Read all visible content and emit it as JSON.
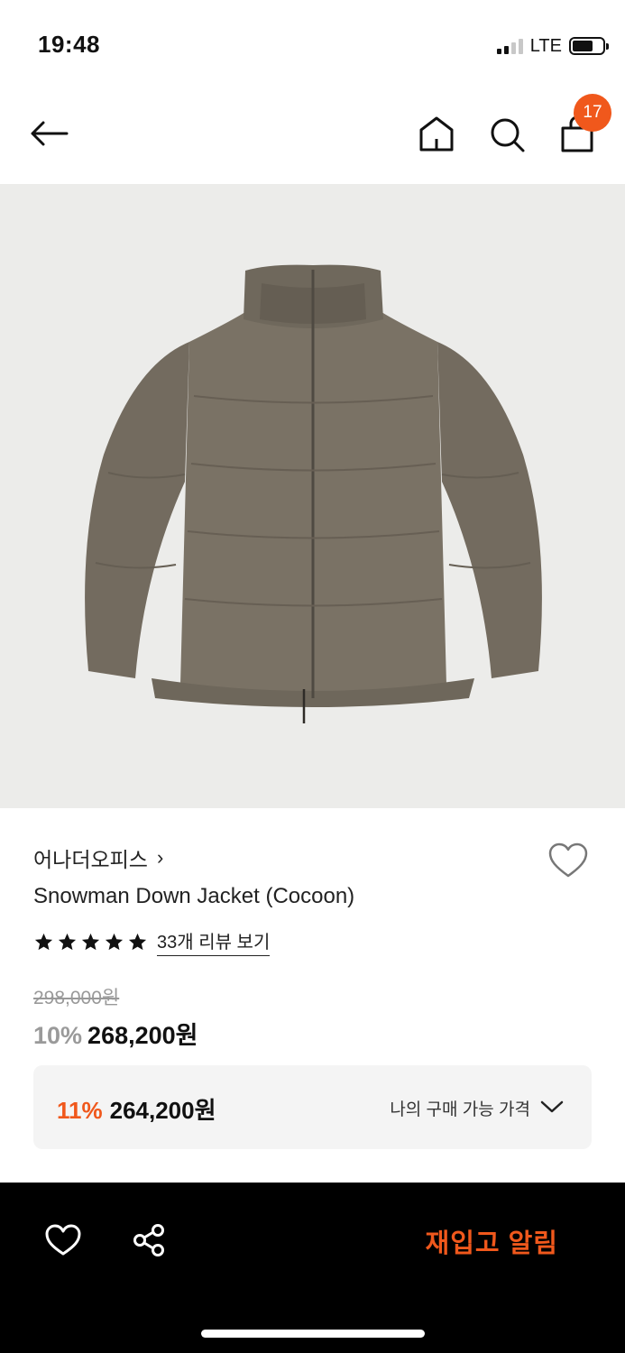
{
  "status_bar": {
    "time": "19:48",
    "network": "LTE"
  },
  "nav": {
    "cart_count": "17"
  },
  "product": {
    "brand": "어나더오피스",
    "brand_chevron": "›",
    "name": "Snowman Down Jacket (Cocoon)",
    "rating_stars": 5,
    "review_link": "33개 리뷰 보기",
    "original_price": "298,000원",
    "discount_rate": "10%",
    "sale_price": "268,200원"
  },
  "my_price": {
    "discount_rate": "11%",
    "price": "264,200원",
    "label": "나의 구매 가능 가격"
  },
  "bottom_bar": {
    "restock_label": "재입고 알림"
  },
  "colors": {
    "accent": "#f0581c",
    "image_bg": "#ececea",
    "jacket": "#7a7265"
  },
  "icons": [
    "back-arrow-icon",
    "home-icon",
    "search-icon",
    "shopping-bag-icon",
    "heart-icon",
    "star-icon",
    "chevron-down-icon",
    "share-icon"
  ]
}
